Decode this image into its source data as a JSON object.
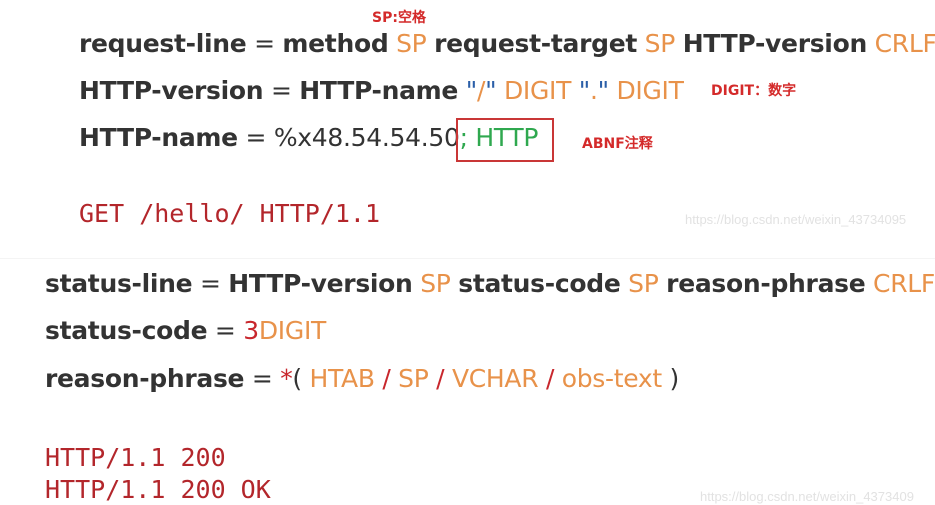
{
  "notes": {
    "sp": "SP:空格",
    "digit": "DIGIT：数字",
    "abnf": "ABNF注释"
  },
  "request": {
    "line1": {
      "name": "request-line",
      "eq": "=",
      "method": "method",
      "sp1": "SP",
      "target": "request-target",
      "sp2": "SP",
      "version": "HTTP-version",
      "crlf": "CRLF"
    },
    "line2": {
      "name": "HTTP-version",
      "eq": "=",
      "hname": "HTTP-name",
      "q1": "\"",
      "slash": "/",
      "q2": "\"",
      "digit1": "DIGIT",
      "q3": "\"",
      "dot": ".",
      "q4": "\"",
      "digit2": "DIGIT"
    },
    "line3": {
      "name": "HTTP-name",
      "eq": "=",
      "hex": "%x48.54.54.50",
      "comment": "; HTTP"
    },
    "example": "GET /hello/ HTTP/1.1"
  },
  "status": {
    "line1": {
      "name": "status-line",
      "eq": "=",
      "version": "HTTP-version",
      "sp1": "SP",
      "code": "status-code",
      "sp2": "SP",
      "phrase": "reason-phrase",
      "crlf": "CRLF"
    },
    "line2": {
      "name": "status-code",
      "eq": "=",
      "count": "3",
      "digit": "DIGIT"
    },
    "line3": {
      "name": "reason-phrase",
      "eq": "=",
      "star": "*",
      "open": "(",
      "htab": "HTAB",
      "s1": "/",
      "sp": "SP",
      "s2": "/",
      "vchar": "VCHAR",
      "s3": "/",
      "obs": "obs-text",
      "close": ")"
    },
    "example1": "HTTP/1.1 200",
    "example2": "HTTP/1.1 200 OK"
  },
  "watermarks": {
    "top": "https://blog.csdn.net/weixin_43734095",
    "bottom": "https://blog.csdn.net/weixin_4373409"
  },
  "colors": {
    "keyword": "#333333",
    "terminal": "#e8924a",
    "comment": "#2fa84f",
    "annotation": "#d42a2a",
    "example": "#b3262b"
  }
}
